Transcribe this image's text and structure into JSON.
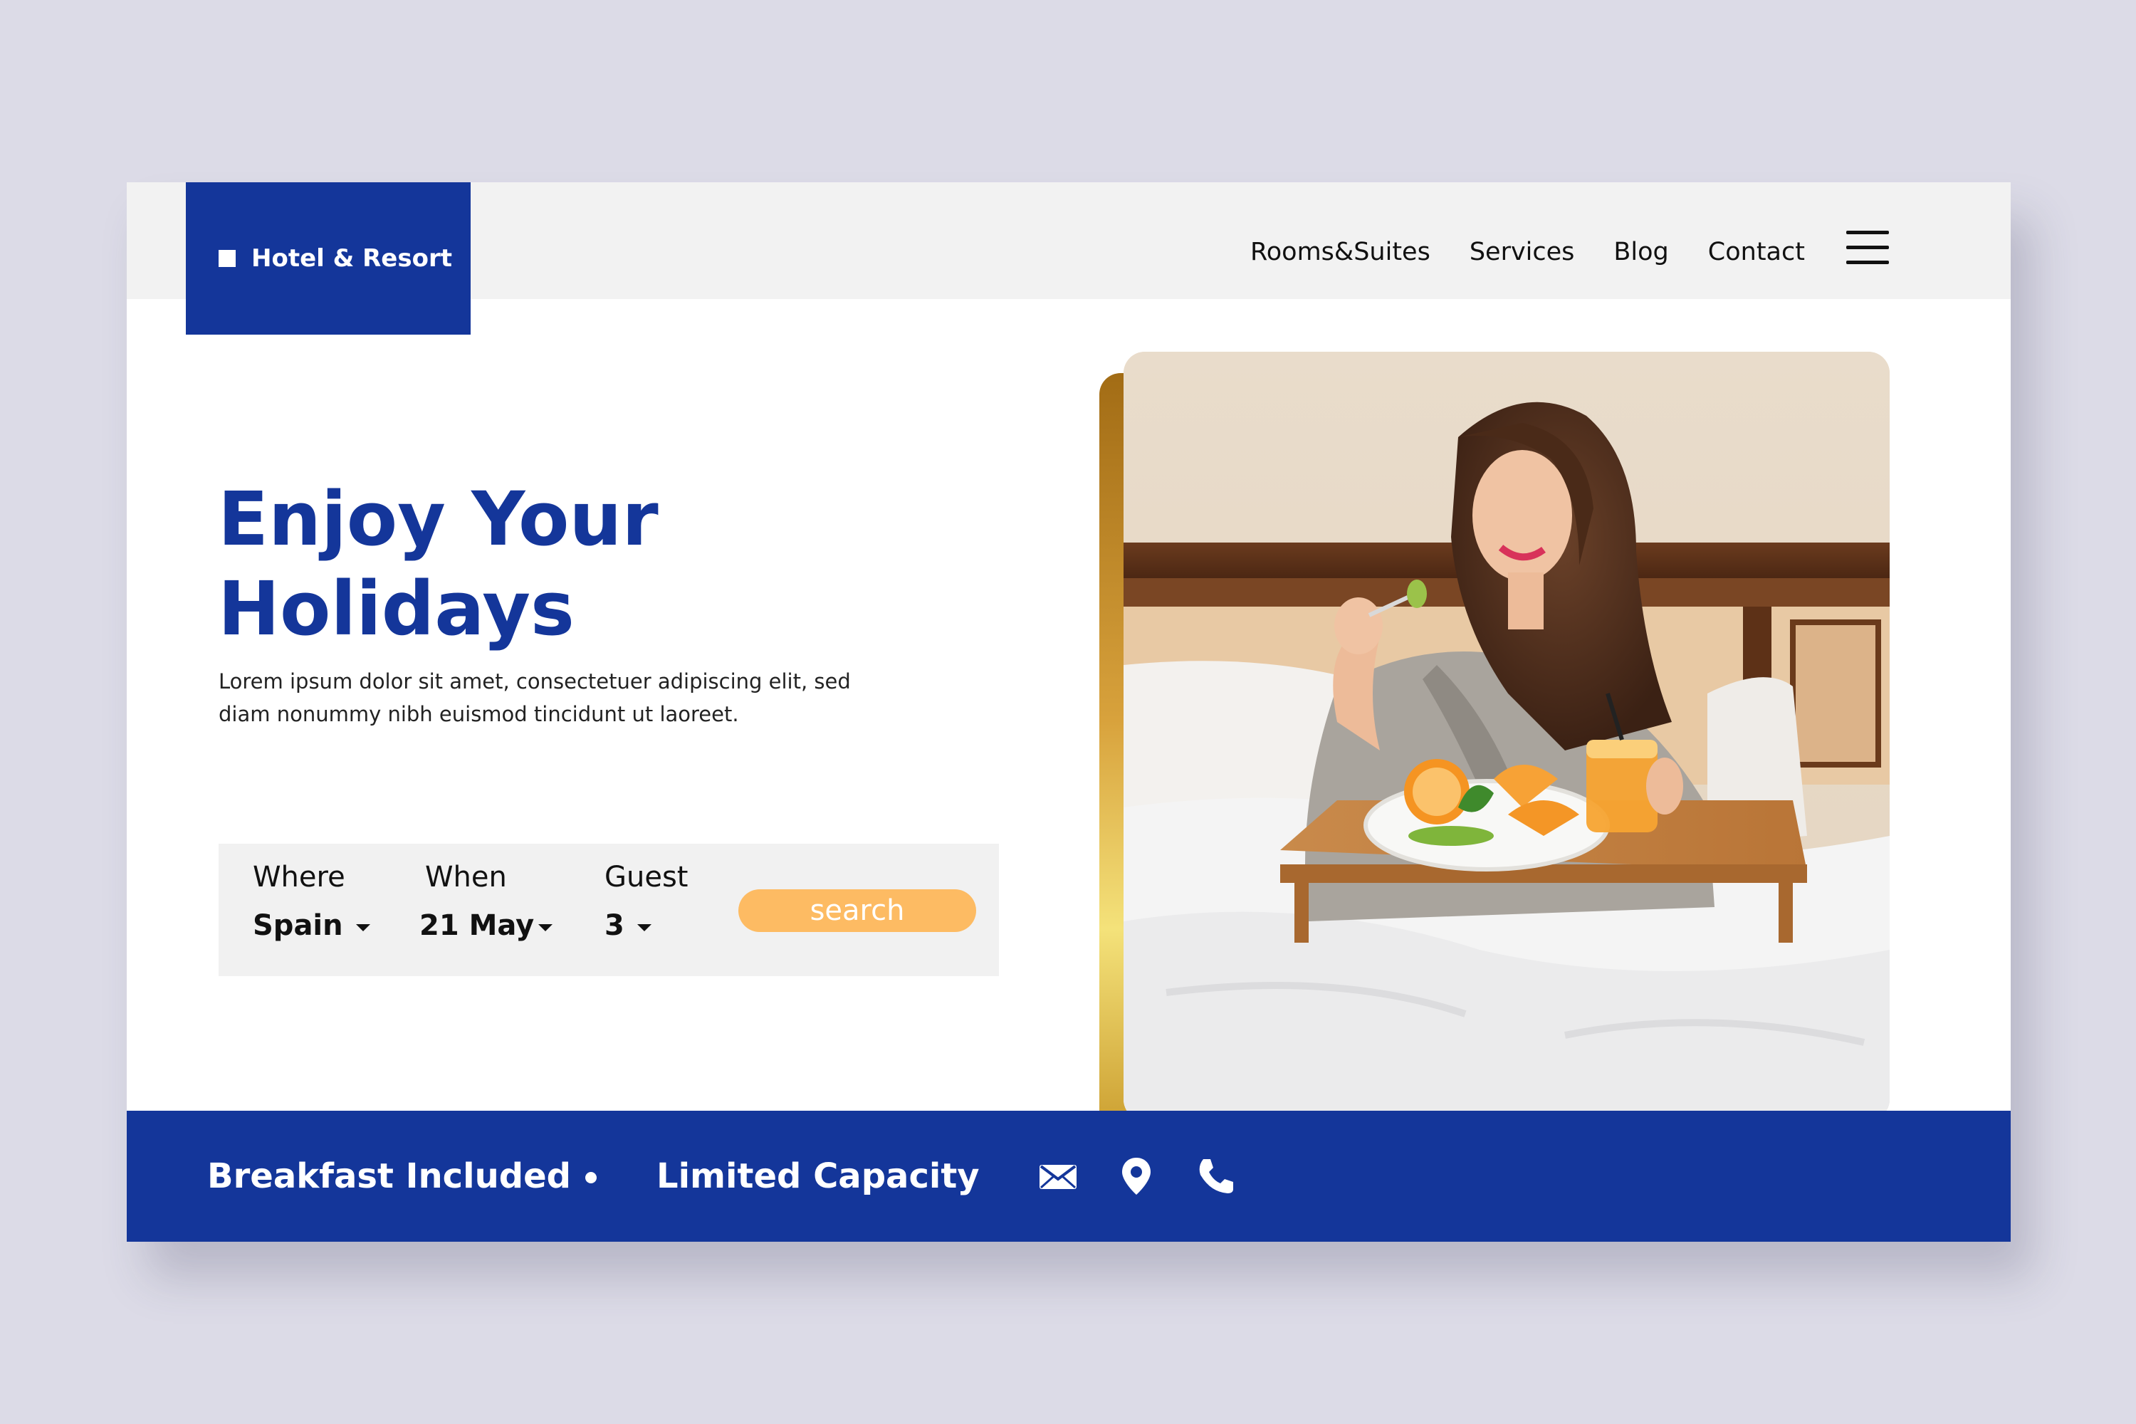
{
  "brand": {
    "name": "Hotel & Resort",
    "color": "#14369a",
    "accent": "#fdbb63"
  },
  "nav": {
    "items": [
      {
        "label": "Rooms&Suites"
      },
      {
        "label": "Services"
      },
      {
        "label": "Blog"
      },
      {
        "label": "Contact"
      }
    ],
    "menu_icon": "hamburger-icon"
  },
  "hero": {
    "title_line1": "Enjoy Your",
    "title_line2": "Holidays",
    "description_line1": "Lorem ipsum dolor sit amet, consectetuer adipiscing elit, sed",
    "description_line2": "diam nonummy nibh euismod tincidunt ut laoreet."
  },
  "search": {
    "where_label": "Where",
    "where_value": "Spain",
    "when_label": "When",
    "when_value": "21 May",
    "guest_label": "Guest",
    "guest_value": "3",
    "button_label": "search"
  },
  "features": {
    "item1": "Breakfast Included",
    "item2": "Limited Capacity"
  },
  "contact_icons": [
    "mail-icon",
    "location-pin-icon",
    "phone-icon"
  ]
}
